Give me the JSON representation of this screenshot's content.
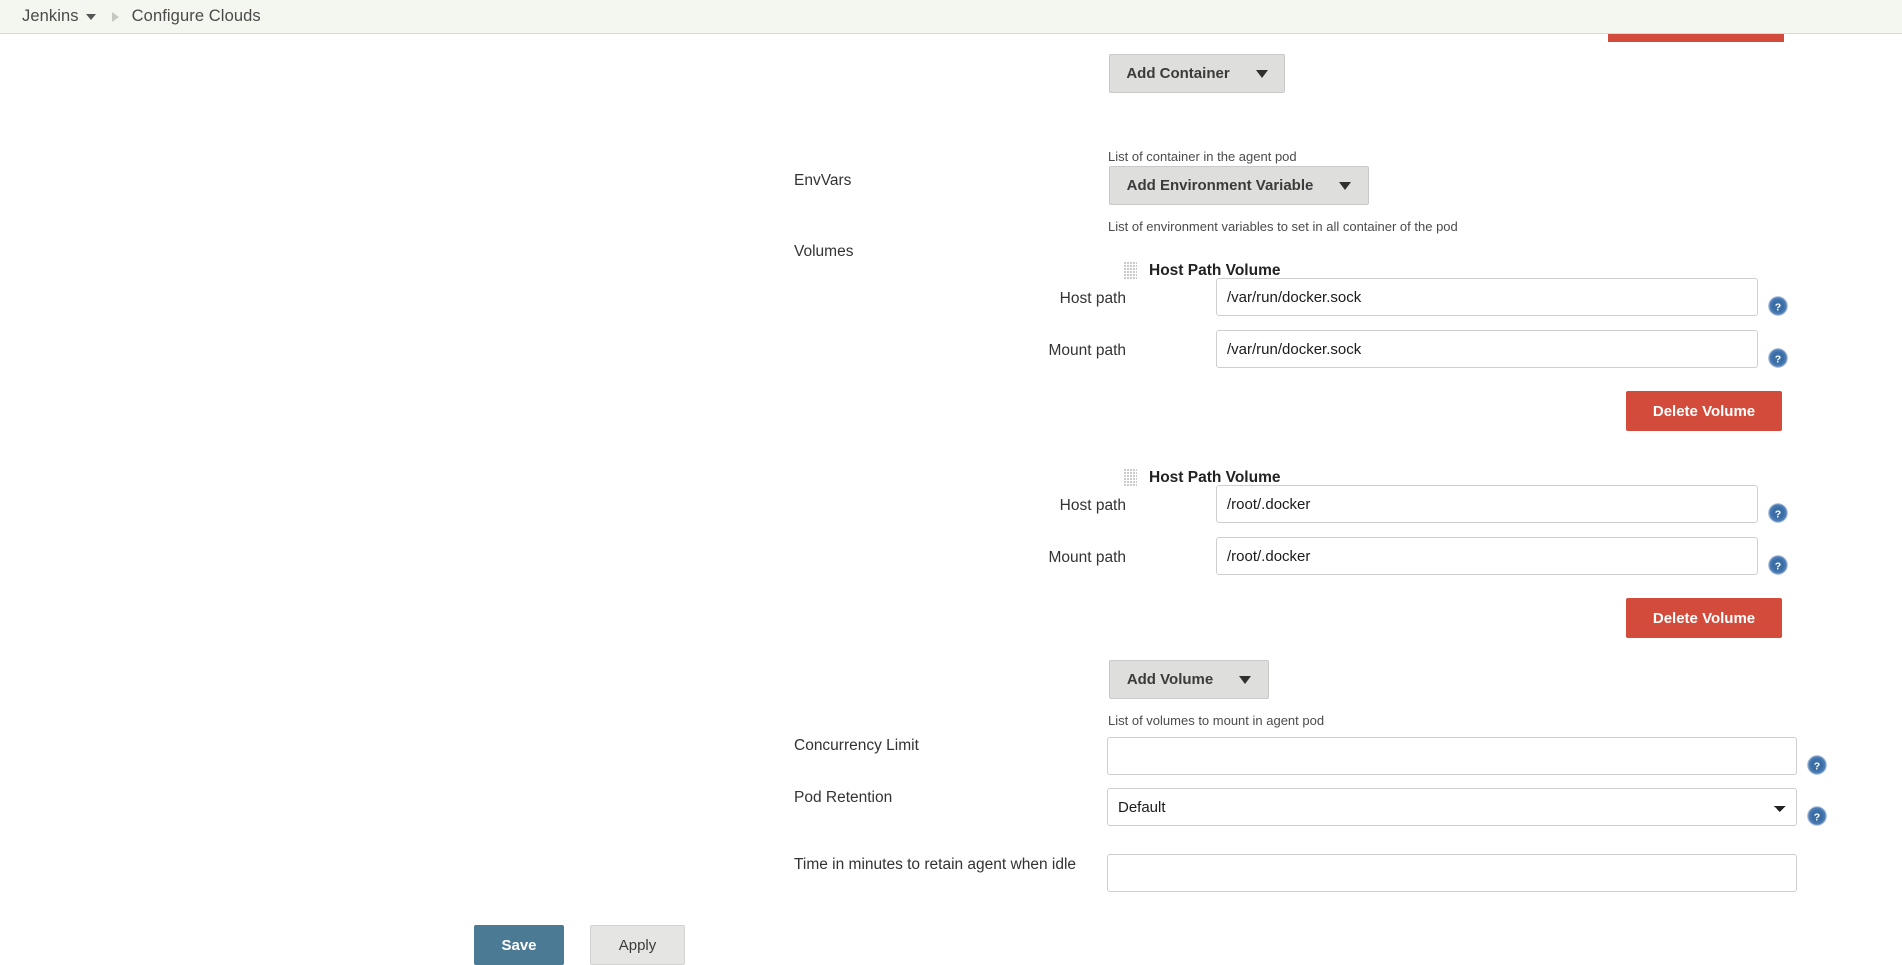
{
  "breadcrumb": {
    "root_label": "Jenkins",
    "caret_icon": "chevron-down-icon",
    "separator_icon": "breadcrumb-separator-icon",
    "current_label": "Configure Clouds"
  },
  "colors": {
    "header_bg": "#f4f7f0",
    "danger": "#d24b3b",
    "save": "#4b7a95",
    "button_grey": "#dededd",
    "help_icon": "#3b6ea5",
    "text": "#333333"
  },
  "form": {
    "containers": {
      "add_button_label": "Add Container",
      "add_button_caret_icon": "chevron-down-icon",
      "description": "List of container in the agent pod"
    },
    "envvars": {
      "label": "EnvVars",
      "add_button_label": "Add Environment Variable",
      "add_button_caret_icon": "chevron-down-icon",
      "description": "List of environment variables to set in all container of the pod"
    },
    "volumes": {
      "label": "Volumes",
      "items": [
        {
          "title": "Host Path Volume",
          "drag_handle_icon": "drag-handle-icon",
          "host_path_label": "Host path",
          "host_path_value": "/var/run/docker.sock",
          "host_path_placeholder": "",
          "mount_path_label": "Mount path",
          "mount_path_value": "/var/run/docker.sock",
          "mount_path_placeholder": "",
          "delete_label": "Delete Volume",
          "help_icon": "help-icon"
        },
        {
          "title": "Host Path Volume",
          "drag_handle_icon": "drag-handle-icon",
          "host_path_label": "Host path",
          "host_path_value": "/root/.docker",
          "host_path_placeholder": "",
          "mount_path_label": "Mount path",
          "mount_path_value": "/root/.docker",
          "mount_path_placeholder": "",
          "delete_label": "Delete Volume",
          "help_icon": "help-icon"
        }
      ],
      "add_button_label": "Add Volume",
      "add_button_caret_icon": "chevron-down-icon",
      "description": "List of volumes to mount in agent pod"
    },
    "concurrency_limit": {
      "label": "Concurrency Limit",
      "value": "",
      "placeholder": "",
      "help_icon": "help-icon"
    },
    "pod_retention": {
      "label": "Pod Retention",
      "selected": "Default",
      "options": [
        "Default"
      ],
      "caret_icon": "chevron-down-icon",
      "help_icon": "help-icon"
    },
    "idle_retention": {
      "label": "Time in minutes to retain agent when idle",
      "value": "",
      "placeholder": ""
    }
  },
  "footer": {
    "save_label": "Save",
    "apply_label": "Apply"
  }
}
